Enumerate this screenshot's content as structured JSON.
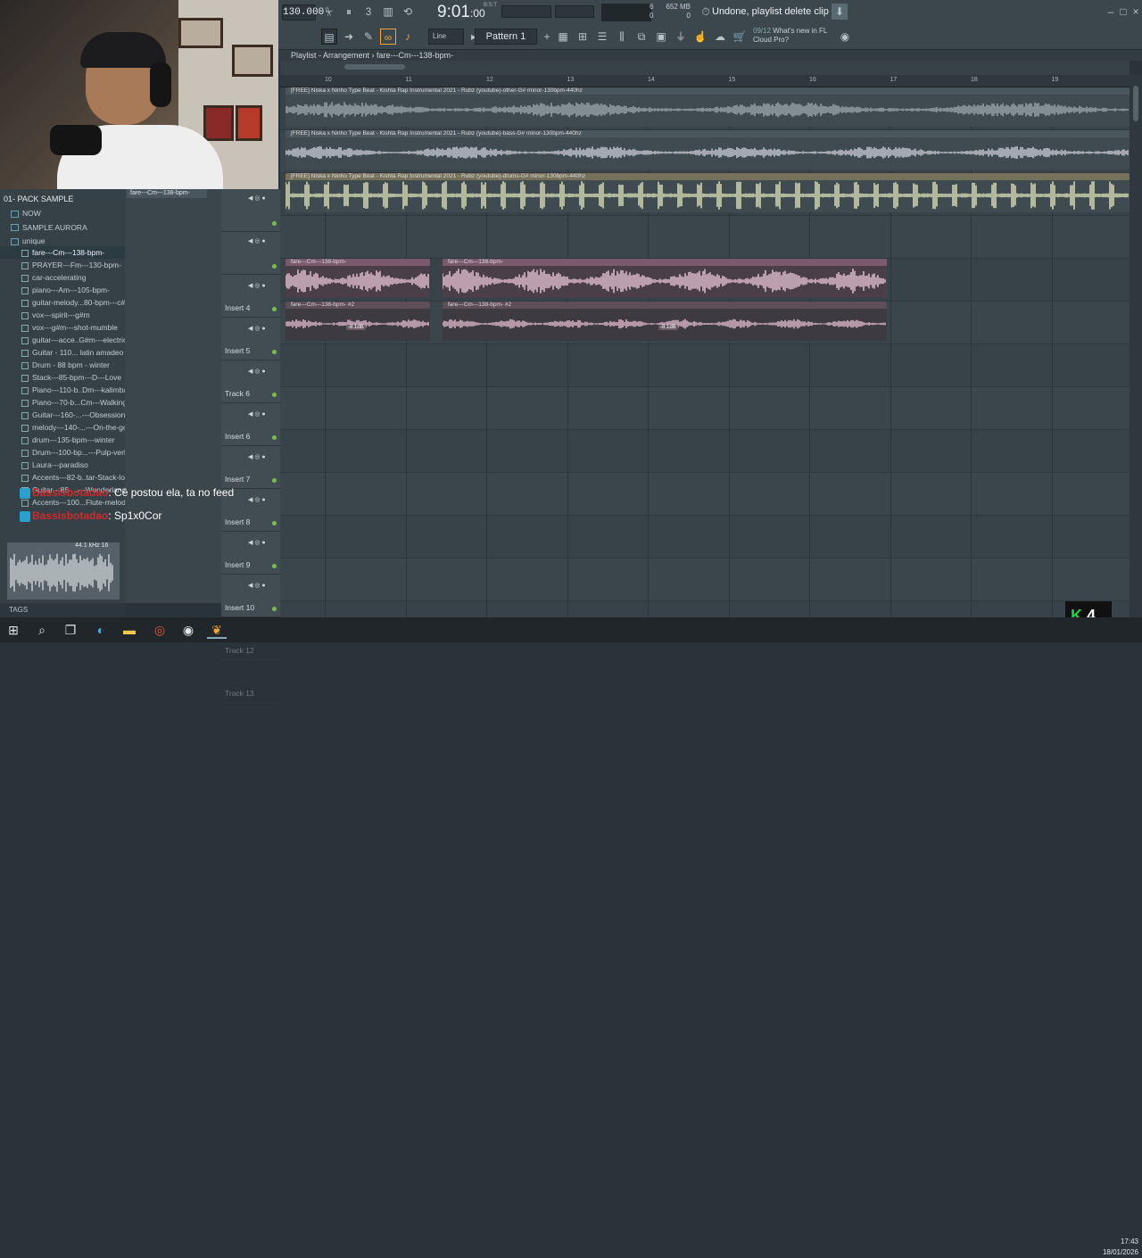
{
  "toolbar": {
    "tempo": "130.000",
    "clock": "9:01",
    "clock_ms": ":00",
    "clock_unit": "B:S:T",
    "hint": "Undone, playlist delete clip",
    "cpu_top": "6",
    "cpu_bottom": "0",
    "mem_top": "652 MB",
    "mem_bottom": "0",
    "snap": "Line",
    "pattern": "Pattern 1",
    "news_date": "09/12",
    "news_text": "What's new in FL Cloud Pro?"
  },
  "playlist": {
    "header": "Playlist - Arrangement  ›  fare---Cm---138-bpm-",
    "ruler": [
      "10",
      "11",
      "12",
      "13",
      "14",
      "15",
      "16",
      "17",
      "18",
      "19"
    ],
    "tracks": [
      {
        "name": "",
        "dim": false
      },
      {
        "name": "",
        "dim": false
      },
      {
        "name": "Insert 4",
        "dim": false
      },
      {
        "name": "Insert 5",
        "dim": false
      },
      {
        "name": "Track 6",
        "dim": false
      },
      {
        "name": "Insert 6",
        "dim": false
      },
      {
        "name": "Insert 7",
        "dim": false
      },
      {
        "name": "Insert 8",
        "dim": false
      },
      {
        "name": "Insert 9",
        "dim": false
      },
      {
        "name": "Insert 10",
        "dim": false
      },
      {
        "name": "Track 12",
        "dim": true
      },
      {
        "name": "Track 13",
        "dim": true
      }
    ],
    "clips": {
      "other": "[FREE] Niska x Ninho Type Beat - Kishta  Rap Instrumental 2021 - Rubz (youtube)-other-G# minor-130bpm-440hz",
      "bass": "[FREE] Niska x Ninho Type Beat - Kishta  Rap Instrumental 2021 - Rubz (youtube)-bass-G# minor-130bpm-440hz",
      "drums": "[FREE] Niska x Ninho Type Beat - Kishta  Rap Instrumental 2021 - Rubz (youtube)-drums-G# minor-130bpm-440hz",
      "fare1a": "fare---Cm---138-bpm-",
      "fare1b": "fare---Cm---138-bpm-",
      "fare2a": "fare---Cm---138-bpm- #2",
      "fare2b": "fare---Cm---138-bpm- #2",
      "db1": "-8.1dB",
      "db2": "-8.1dB"
    }
  },
  "browser": {
    "title": "01- PACK SAMPLE",
    "left_label": "fare---Cm---138-bpm-",
    "folders": [
      "NOW",
      "SAMPLE AURORA",
      "unique"
    ],
    "files": [
      "fare---Cm---138-bpm-",
      "PRAYER---Fm---130-bpm-",
      "car-accelerating",
      "piano---Am---105-bpm-",
      "guitar-melody...80-bpm---c#",
      "vox---spirit---g#m",
      "vox---g#m---shot-mumble",
      "guitar---acce..G#m---electric",
      "Guitar - 110...  latin amadeo",
      "Drum - 88 bpm - winter",
      "Stack---85-bpm---D---Love",
      "Piano---110-b..Dm---kalimba",
      "Piano---70-b...Cm---Walking",
      "Guitar---160-...---Obsession",
      "melody---140-...---On-the-go",
      "drum---135-bpm---winter",
      "Drum---100-bp...---Pulp-verb",
      "Laura---paradiso",
      "Accents---82-b..tar-Stack-lofi",
      "Guitar---85-...---Wonderland",
      "Accents---100...Flute-melody"
    ],
    "preview_info": "44.1 kHz 16",
    "tags_label": "TAGS"
  },
  "chat": [
    {
      "user": "Bassisbotadao",
      "message": ": Cê postou ela, ta no feed"
    },
    {
      "user": "Bassisbotadao",
      "message": ": Sp1x0Cor"
    }
  ],
  "overlay": {
    "logo": "K",
    "logo_num": "4"
  },
  "system": {
    "time": "17:43",
    "date": "18/01/2026"
  },
  "colors": {
    "accent": "#f2a23a",
    "green": "#7ac042",
    "clip_pink": "#c9a7b7",
    "clip_drum": "#c8cfa8"
  }
}
